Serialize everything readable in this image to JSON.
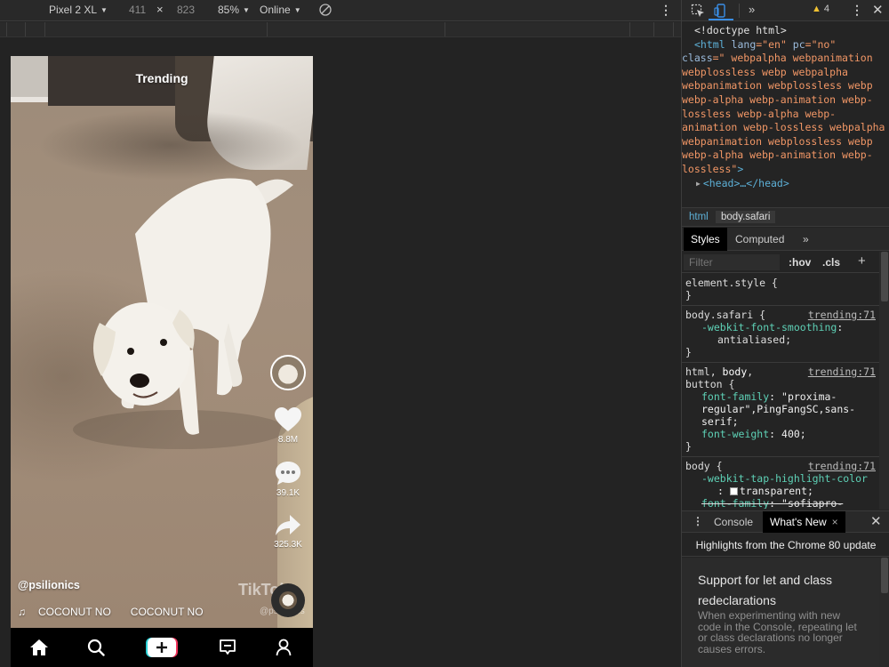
{
  "device_toolbar": {
    "device": "Pixel 2 XL",
    "width": "411",
    "times": "×",
    "height": "823",
    "zoom": "85%",
    "network": "Online",
    "more": "⋮"
  },
  "tiktok": {
    "header": "Trending",
    "likes": "8.8M",
    "comments": "39.1K",
    "shares": "325.3K",
    "username": "@psilionics",
    "music_note": "♫",
    "music_text_1": "COCONUT NO",
    "music_text_2": "COCONUT NO",
    "watermark": "TikTok",
    "watermark_user": "@psilionics"
  },
  "devtools": {
    "chevron": "»",
    "warning_count": "4",
    "more": "⋮",
    "close": "✕",
    "dom": {
      "doctype": "<!doctype html>",
      "html_open": "<html",
      "lang_attr": " lang",
      "lang_val": "=\"en\"",
      "pc_attr": " pc",
      "pc_val": "=\"no\"",
      "class_attr": "class",
      "class_val": "=\"   webpalpha webpanimation webplossless webp webpalpha webpanimation webplossless webp webp-alpha webp-animation webp-lossless webp-alpha webp-animation webp-lossless  webpalpha webpanimation webplossless webp webp-alpha webp-animation webp-lossless\"",
      "close_bracket": ">",
      "head": "<head>…</head>"
    },
    "breadcrumbs": [
      "html",
      "body.safari"
    ],
    "styles_tabs": {
      "styles": "Styles",
      "computed": "Computed",
      "more": "»"
    },
    "filter": {
      "placeholder": "Filter",
      "hov": ":hov",
      "cls": ".cls",
      "plus": "+"
    },
    "rules": {
      "r1_selector": "element.style {",
      "r1_close": "}",
      "r2_selector": "body.safari {",
      "r2_source": "trending:71",
      "r2_prop": "-webkit-font-smoothing",
      "r2_value": "antialiased;",
      "r2_close": "}",
      "r3_selector_a": "html, ",
      "r3_selector_b": "body",
      "r3_selector_c": ",",
      "r3_selector_d": "button {",
      "r3_source": "trending:71",
      "r3_prop1": "font-family",
      "r3_val1": "\"proxima-regular\",PingFangSC,sans-serif;",
      "r3_prop2": "font-weight",
      "r3_val2": "400;",
      "r3_close": "}",
      "r4_selector": "body {",
      "r4_source": "trending:71",
      "r4_prop1": "-webkit-tap-highlight-color",
      "r4_val1": "transparent;",
      "r4_prop2": "font-family",
      "r4_val2": "\"sofiapro-"
    },
    "drawer": {
      "menu": "⋮",
      "console": "Console",
      "whats_new": "What's New",
      "whats_new_close": "×",
      "close": "✕",
      "highlights": "Highlights from the Chrome 80 update",
      "feature_title": "Support for let and class redeclarations",
      "feature_body": "When experimenting with new code in the Console, repeating let or class declarations no longer causes errors."
    }
  },
  "colors": {
    "accent_blue": "#3a8ee6",
    "warning_yellow": "#f1c232",
    "tag_blue": "#5db0d7",
    "attr_orange": "#f29766",
    "prop_teal": "#5ed1b6"
  }
}
